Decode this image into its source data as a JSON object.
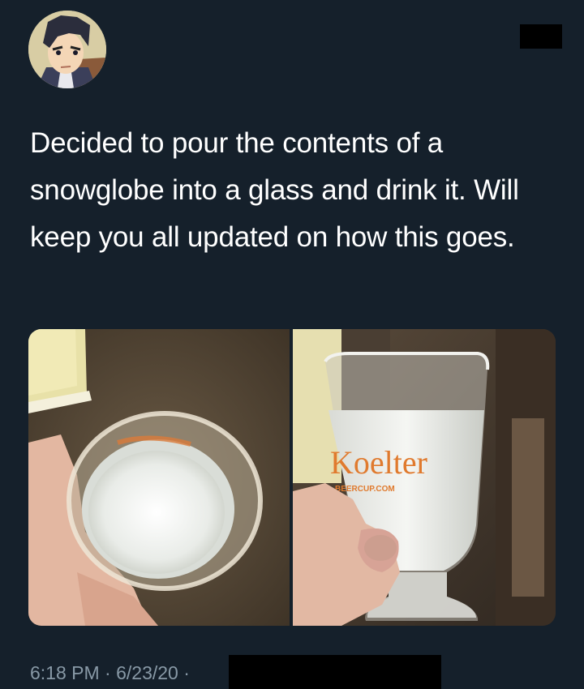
{
  "tweet": {
    "text": "Decided to pour the contents of a snowglobe into a glass and drink it. Will keep you all updated on how this goes.",
    "time": "6:18 PM",
    "date": "6/23/20",
    "separator": "·"
  },
  "media": {
    "glass_brand": "Koelter",
    "glass_url": "BEERCUP.COM"
  },
  "colors": {
    "background": "#15202b",
    "text": "#ffffff",
    "meta": "#8899a6",
    "redaction": "#000000"
  }
}
